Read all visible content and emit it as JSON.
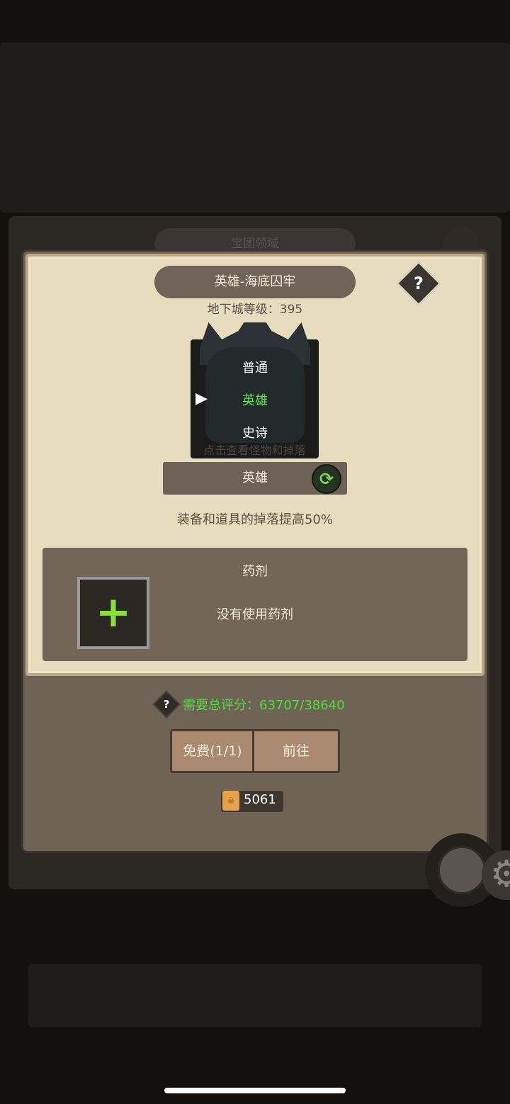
{
  "background": {
    "title": "宝团领域"
  },
  "dialog": {
    "title": "英雄-海底囚牢",
    "help_icon": "?",
    "dungeon_level": "地下城等级：395",
    "difficulty_options": [
      "普通",
      "英雄",
      "史诗"
    ],
    "selected_difficulty": "英雄",
    "monster_hint": "点击查看怪物和掉落",
    "current_difficulty": "英雄",
    "drop_bonus": "装备和道具的掉落提高50%",
    "potion": {
      "title": "药剂",
      "status": "没有使用药剂",
      "add_icon": "+"
    },
    "requirement": {
      "help_icon": "?",
      "text": "需要总评分：63707/38640"
    },
    "buttons": {
      "free": "免费(1/1)",
      "go": "前往"
    },
    "scroll_count": "5061"
  },
  "colors": {
    "accent_green": "#4ce03a",
    "paper": "#e8dcbf",
    "wood": "#a98a71"
  }
}
